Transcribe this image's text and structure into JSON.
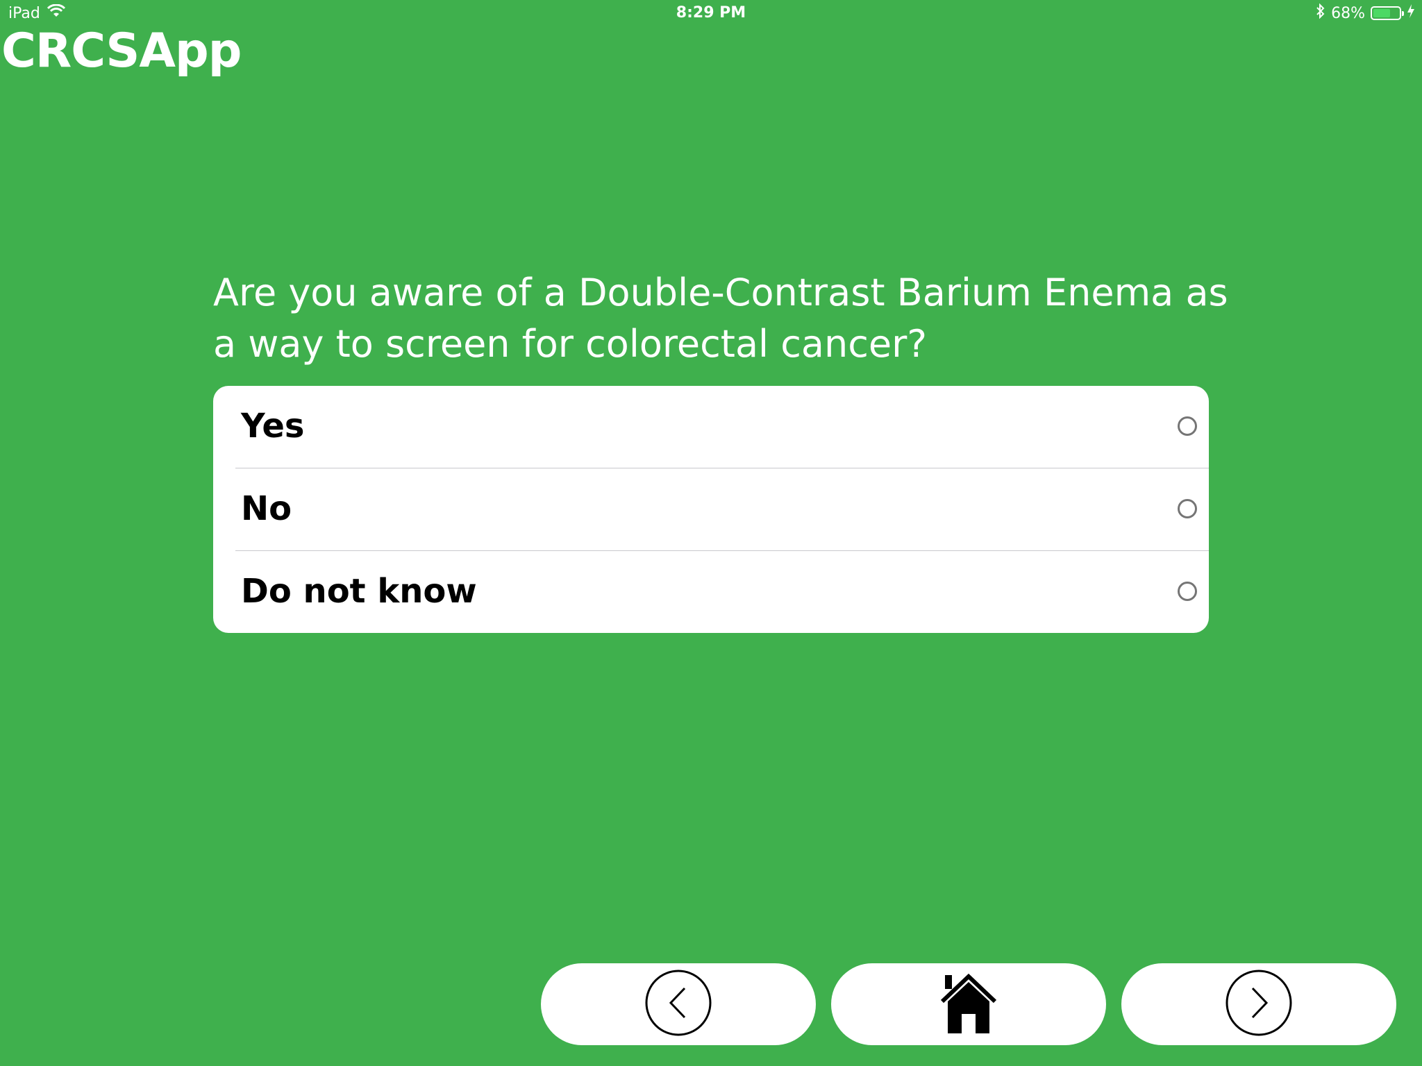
{
  "status_bar": {
    "device": "iPad",
    "time": "8:29 PM",
    "battery_percent": "68%",
    "battery_level": 0.68,
    "battery_color": "#4cd964"
  },
  "app": {
    "title": "CRCSApp",
    "background_color": "#3fb04d"
  },
  "question": {
    "text": "Are you aware of a Double-Contrast Barium Enema as a way to screen for colorectal cancer?"
  },
  "options": [
    {
      "label": "Yes",
      "selected": false
    },
    {
      "label": "No",
      "selected": false
    },
    {
      "label": "Do not know",
      "selected": false
    }
  ],
  "nav": {
    "back_icon": "chevron-left-circle-icon",
    "home_icon": "home-icon",
    "next_icon": "chevron-right-circle-icon"
  }
}
